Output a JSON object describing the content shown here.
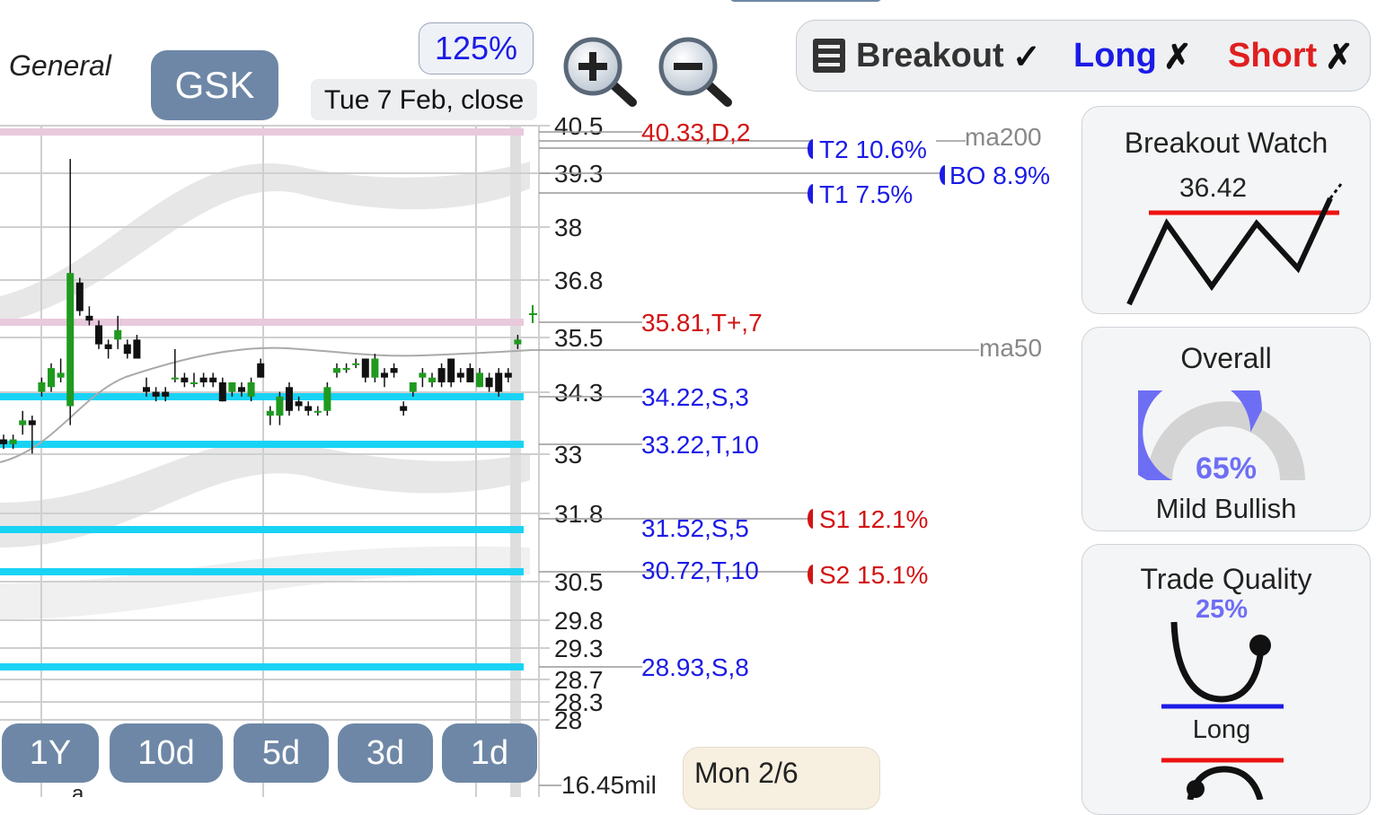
{
  "header": {
    "category": "General",
    "ticker": "GSK",
    "zoom_level": "125%",
    "date_label": "Tue 7 Feb, close"
  },
  "strategy_bar": {
    "breakout_label": "Breakout",
    "breakout_mark": "✓",
    "long_label": "Long",
    "long_mark": "✗",
    "short_label": "Short",
    "short_mark": "✗",
    "menu_icon": "list-icon"
  },
  "colors": {
    "accent": "#6e87a6",
    "support_line": "#19d3f5",
    "resistance_line": "#e9c9dc",
    "blue_text": "#1b1be6",
    "red_text": "#d21414",
    "candle_up": "#1f9a1f",
    "candle_down": "#111111"
  },
  "price_axis": {
    "ticks": [
      "40.5",
      "39.3",
      "38",
      "36.8",
      "35.5",
      "34.3",
      "33",
      "31.8",
      "30.5",
      "29.8",
      "29.3",
      "28.7",
      "28.3",
      "28"
    ],
    "volume_label": "16.45mil"
  },
  "levels": [
    {
      "label": "40.33,D,2",
      "color": "red"
    },
    {
      "label": "35.81,T+,7",
      "color": "red"
    },
    {
      "label": "34.22,S,3",
      "color": "blue"
    },
    {
      "label": "33.22,T,10",
      "color": "blue"
    },
    {
      "label": "31.52,S,5",
      "color": "blue"
    },
    {
      "label": "30.72,T,10",
      "color": "blue"
    },
    {
      "label": "28.93,S,8",
      "color": "blue"
    }
  ],
  "targets": {
    "t2": "T2 10.6%",
    "bo": "BO 8.9%",
    "t1": "T1 7.5%",
    "s1": "S1 12.1%",
    "s2": "S2 15.1%"
  },
  "moving_averages": {
    "ma200": "ma200",
    "ma50": "ma50"
  },
  "range_buttons": [
    "1Y",
    "10d",
    "5d",
    "3d",
    "1d"
  ],
  "hover_date": "Mon 2/6",
  "bottom_axis_mark": "a",
  "panels": {
    "breakout_watch": {
      "title": "Breakout Watch",
      "value": "36.42"
    },
    "overall": {
      "title": "Overall",
      "value": "65%",
      "percent": 65,
      "verdict": "Mild Bullish"
    },
    "trade_quality": {
      "title": "Trade Quality",
      "value": "25%",
      "percent": 25,
      "long_label": "Long"
    }
  },
  "chart_data": {
    "type": "candlestick",
    "ylim": [
      28,
      40.5
    ],
    "candles": [
      {
        "o": 33.9,
        "h": 34.0,
        "l": 33.7,
        "c": 33.8
      },
      {
        "o": 33.8,
        "h": 34.0,
        "l": 33.7,
        "c": 33.9
      },
      {
        "o": 34.2,
        "h": 34.5,
        "l": 34.0,
        "c": 34.3
      },
      {
        "o": 34.3,
        "h": 34.4,
        "l": 33.6,
        "c": 34.2
      },
      {
        "o": 34.9,
        "h": 35.2,
        "l": 34.8,
        "c": 35.1
      },
      {
        "o": 35.0,
        "h": 35.5,
        "l": 34.9,
        "c": 35.4
      },
      {
        "o": 35.2,
        "h": 35.6,
        "l": 35.1,
        "c": 35.3
      },
      {
        "o": 34.6,
        "h": 39.8,
        "l": 34.2,
        "c": 37.4
      },
      {
        "o": 37.2,
        "h": 37.3,
        "l": 36.5,
        "c": 36.6
      },
      {
        "o": 36.5,
        "h": 36.7,
        "l": 36.3,
        "c": 36.4
      },
      {
        "o": 36.3,
        "h": 36.4,
        "l": 35.8,
        "c": 35.9
      },
      {
        "o": 35.9,
        "h": 36.0,
        "l": 35.6,
        "c": 35.8
      },
      {
        "o": 36.0,
        "h": 36.5,
        "l": 35.8,
        "c": 36.2
      },
      {
        "o": 35.9,
        "h": 36.0,
        "l": 35.6,
        "c": 35.7
      },
      {
        "o": 36.0,
        "h": 36.1,
        "l": 35.6,
        "c": 35.6
      },
      {
        "o": 35.0,
        "h": 35.2,
        "l": 34.8,
        "c": 34.9
      },
      {
        "o": 34.9,
        "h": 35.0,
        "l": 34.7,
        "c": 34.8
      },
      {
        "o": 34.9,
        "h": 35.0,
        "l": 34.7,
        "c": 34.8
      },
      {
        "o": 35.2,
        "h": 35.8,
        "l": 35.1,
        "c": 35.2
      },
      {
        "o": 35.2,
        "h": 35.3,
        "l": 35.0,
        "c": 35.1
      },
      {
        "o": 35.1,
        "h": 35.3,
        "l": 35.0,
        "c": 35.1
      },
      {
        "o": 35.2,
        "h": 35.3,
        "l": 35.0,
        "c": 35.1
      },
      {
        "o": 35.2,
        "h": 35.3,
        "l": 35.0,
        "c": 35.1
      },
      {
        "o": 35.1,
        "h": 35.2,
        "l": 34.7,
        "c": 34.7
      },
      {
        "o": 34.9,
        "h": 35.1,
        "l": 34.8,
        "c": 35.1
      },
      {
        "o": 35.0,
        "h": 35.1,
        "l": 34.8,
        "c": 34.9
      },
      {
        "o": 34.8,
        "h": 35.2,
        "l": 34.7,
        "c": 35.1
      },
      {
        "o": 35.5,
        "h": 35.6,
        "l": 35.2,
        "c": 35.2
      },
      {
        "o": 34.4,
        "h": 34.6,
        "l": 34.2,
        "c": 34.5
      },
      {
        "o": 34.4,
        "h": 34.9,
        "l": 34.2,
        "c": 34.8
      },
      {
        "o": 35.0,
        "h": 35.1,
        "l": 34.4,
        "c": 34.5
      },
      {
        "o": 34.7,
        "h": 34.8,
        "l": 34.5,
        "c": 34.6
      },
      {
        "o": 34.6,
        "h": 34.7,
        "l": 34.4,
        "c": 34.5
      },
      {
        "o": 34.5,
        "h": 34.6,
        "l": 34.4,
        "c": 34.5
      },
      {
        "o": 34.5,
        "h": 35.1,
        "l": 34.4,
        "c": 35.0
      },
      {
        "o": 35.3,
        "h": 35.5,
        "l": 35.2,
        "c": 35.4
      },
      {
        "o": 35.4,
        "h": 35.5,
        "l": 35.3,
        "c": 35.4
      },
      {
        "o": 35.5,
        "h": 35.6,
        "l": 35.4,
        "c": 35.5
      },
      {
        "o": 35.6,
        "h": 35.6,
        "l": 35.1,
        "c": 35.2
      },
      {
        "o": 35.2,
        "h": 35.7,
        "l": 35.1,
        "c": 35.6
      },
      {
        "o": 35.3,
        "h": 35.4,
        "l": 35.0,
        "c": 35.2
      },
      {
        "o": 35.4,
        "h": 35.5,
        "l": 35.2,
        "c": 35.3
      },
      {
        "o": 34.6,
        "h": 34.7,
        "l": 34.4,
        "c": 34.5
      },
      {
        "o": 34.9,
        "h": 35.1,
        "l": 34.8,
        "c": 35.1
      },
      {
        "o": 35.2,
        "h": 35.4,
        "l": 35.0,
        "c": 35.3
      },
      {
        "o": 35.1,
        "h": 35.3,
        "l": 35.0,
        "c": 35.2
      },
      {
        "o": 35.4,
        "h": 35.5,
        "l": 35.0,
        "c": 35.1
      },
      {
        "o": 35.6,
        "h": 35.6,
        "l": 35.0,
        "c": 35.1
      },
      {
        "o": 35.3,
        "h": 35.4,
        "l": 35.1,
        "c": 35.2
      },
      {
        "o": 35.4,
        "h": 35.5,
        "l": 35.1,
        "c": 35.1
      },
      {
        "o": 35.0,
        "h": 35.4,
        "l": 35.0,
        "c": 35.3
      },
      {
        "o": 35.2,
        "h": 35.3,
        "l": 34.9,
        "c": 35.0
      },
      {
        "o": 35.3,
        "h": 35.4,
        "l": 34.8,
        "c": 34.9
      },
      {
        "o": 35.3,
        "h": 35.4,
        "l": 35.1,
        "c": 35.2
      },
      {
        "o": 35.9,
        "h": 36.1,
        "l": 35.8,
        "c": 36.0
      }
    ]
  }
}
